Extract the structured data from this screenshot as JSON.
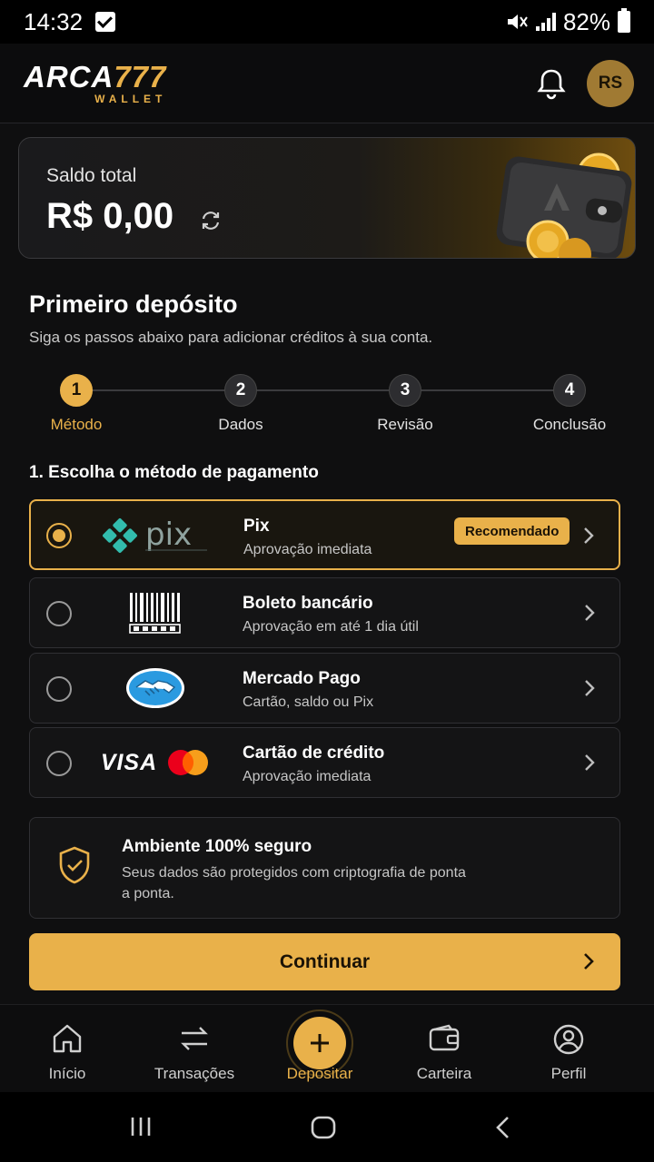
{
  "status_bar": {
    "time": "14:32",
    "battery": "82%"
  },
  "header": {
    "logo_main_white": "ARCA",
    "logo_main_gold": "777",
    "logo_sub": "WALLET",
    "avatar_initials": "RS"
  },
  "balance": {
    "label": "Saldo total",
    "value": "R$ 0,00"
  },
  "section": {
    "title": "Primeiro depósito",
    "subtitle": "Siga os passos abaixo para adicionar créditos à sua conta."
  },
  "steps": [
    {
      "number": "1",
      "label": "Método",
      "active": true
    },
    {
      "number": "2",
      "label": "Dados"
    },
    {
      "number": "3",
      "label": "Revisão"
    },
    {
      "number": "4",
      "label": "Conclusão"
    }
  ],
  "payment": {
    "heading": "1. Escolha o método de pagamento",
    "methods": [
      {
        "name": "Pix",
        "description": "Aprovação imediata",
        "badge": "Recomendado",
        "selected": true,
        "logo": "pix-logo"
      },
      {
        "name": "Boleto bancário",
        "description": "Aprovação em até 1 dia útil",
        "logo": "barcode-icon"
      },
      {
        "name": "Mercado Pago",
        "description": "Cartão, saldo ou Pix",
        "logo": "mercado-pago-logo"
      },
      {
        "name": "Cartão de crédito",
        "description": "Aprovação imediata",
        "logo": "visa-mastercard-logo",
        "logo_text": "VISA"
      }
    ]
  },
  "security": {
    "title": "Ambiente 100% seguro",
    "text": "Seus dados são protegidos com criptografia de ponta a ponta."
  },
  "continue_label": "Continuar",
  "bottom_nav": [
    {
      "label": "Início",
      "icon": "home-icon"
    },
    {
      "label": "Transações",
      "icon": "transfer-icon"
    },
    {
      "label": "Depositar",
      "icon": "plus-icon",
      "active": true
    },
    {
      "label": "Carteira",
      "icon": "wallet-icon"
    },
    {
      "label": "Perfil",
      "icon": "user-icon"
    }
  ],
  "colors": {
    "accent": "#e9b14a",
    "background": "#0f0f10",
    "card": "#141415"
  }
}
